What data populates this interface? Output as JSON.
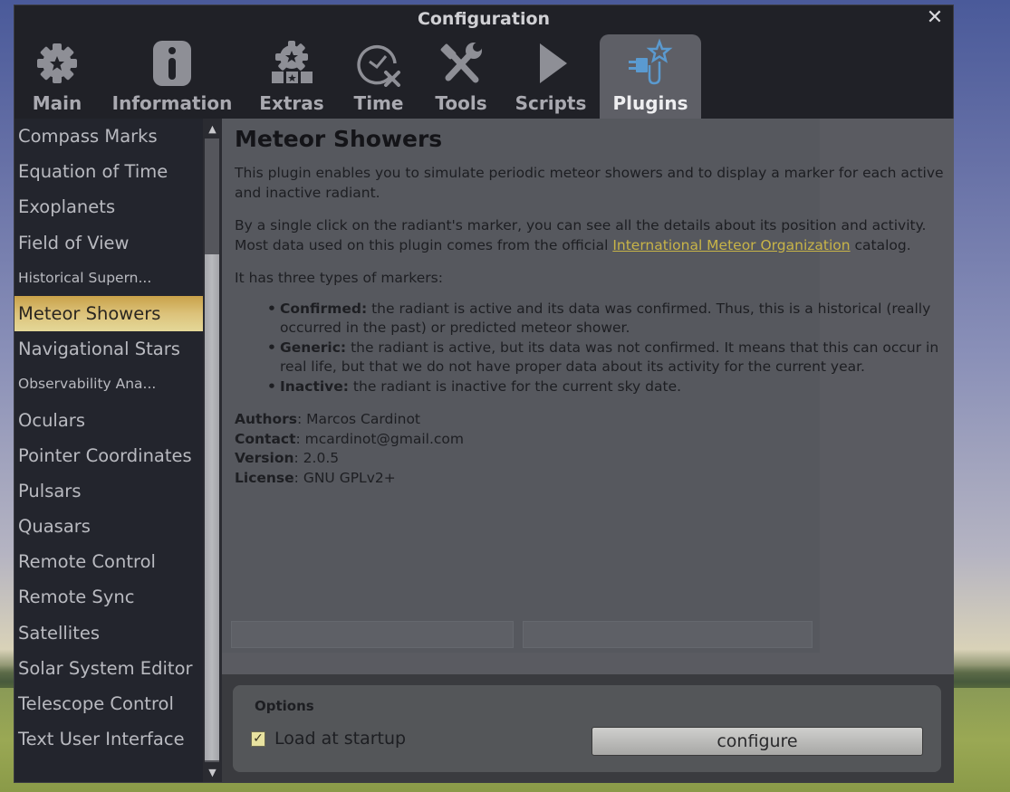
{
  "window": {
    "title": "Configuration",
    "close_label": "✕"
  },
  "tabs": [
    {
      "label": "Main",
      "icon": "gear-star-icon"
    },
    {
      "label": "Information",
      "icon": "info-icon"
    },
    {
      "label": "Extras",
      "icon": "extras-gear-icon"
    },
    {
      "label": "Time",
      "icon": "clock-tools-icon"
    },
    {
      "label": "Tools",
      "icon": "hammer-wrench-icon"
    },
    {
      "label": "Scripts",
      "icon": "play-icon"
    },
    {
      "label": "Plugins",
      "icon": "plug-star-icon",
      "active": true
    }
  ],
  "sidebar": {
    "items": [
      {
        "label": "Compass Marks"
      },
      {
        "label": "Equation of Time"
      },
      {
        "label": "Exoplanets"
      },
      {
        "label": "Field of View"
      },
      {
        "label": "Historical Supern..."
      },
      {
        "label": "Meteor Showers",
        "selected": true
      },
      {
        "label": "Navigational Stars"
      },
      {
        "label": "Observability Ana..."
      },
      {
        "label": "Oculars"
      },
      {
        "label": "Pointer Coordinates"
      },
      {
        "label": "Pulsars"
      },
      {
        "label": "Quasars"
      },
      {
        "label": "Remote Control"
      },
      {
        "label": "Remote Sync"
      },
      {
        "label": "Satellites"
      },
      {
        "label": "Solar System Editor"
      },
      {
        "label": "Telescope Control"
      },
      {
        "label": "Text User Interface"
      }
    ],
    "scroll_up": "▲",
    "scroll_down": "▼"
  },
  "plugin": {
    "title": "Meteor Showers",
    "intro": "This plugin enables you to simulate periodic meteor showers and to display a marker for each active and inactive radiant.",
    "para2_before": "By a single click on the radiant's marker, you can see all the details about its position and activity. Most data used on this plugin comes from the official ",
    "para2_link": "International Meteor Organization",
    "para2_after": " catalog.",
    "markers_intro": "It has three types of markers:",
    "markers": [
      {
        "name": "Confirmed:",
        "text": " the radiant is active and its data was confirmed. Thus, this is a historical (really occurred in the past) or predicted meteor shower."
      },
      {
        "name": "Generic:",
        "text": " the radiant is active, but its data was not confirmed. It means that this can occur in real life, but that we do not have proper data about its activity for the current year."
      },
      {
        "name": "Inactive:",
        "text": " the radiant is inactive for the current sky date."
      }
    ],
    "meta": [
      {
        "key": "Authors",
        "value": ": Marcos Cardinot"
      },
      {
        "key": "Contact",
        "value": ": mcardinot@gmail.com"
      },
      {
        "key": "Version",
        "value": ": 2.0.5"
      },
      {
        "key": "License",
        "value": ": GNU GPLv2+"
      }
    ]
  },
  "options": {
    "title": "Options",
    "load_at_startup_label": "Load at startup",
    "load_at_startup_checked": true,
    "check_mark": "✓",
    "configure_label": "configure"
  },
  "colors": {
    "selected_item": "#dcc27a",
    "link": "#c8b448",
    "plugin_icon": "#5a9ad0"
  }
}
